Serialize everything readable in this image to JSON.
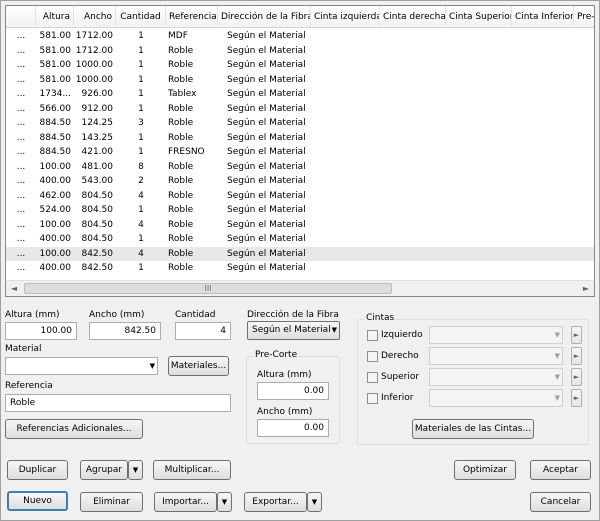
{
  "grid": {
    "columns": [
      "",
      "Altura",
      "Ancho",
      "Cantidad",
      "Referencia",
      "Dirección de la Fibra",
      "Cinta izquierda",
      "Cinta derecha",
      "Cinta Superior",
      "Cinta Inferior",
      "Pre-"
    ],
    "rows": [
      {
        "lead": "...",
        "altura": "581.00",
        "ancho": "1712.00",
        "cantidad": "1",
        "referencia": "MDF",
        "fibra": "Según el Material"
      },
      {
        "lead": "...",
        "altura": "581.00",
        "ancho": "1712.00",
        "cantidad": "1",
        "referencia": "Roble",
        "fibra": "Según el Material"
      },
      {
        "lead": "...",
        "altura": "581.00",
        "ancho": "1000.00",
        "cantidad": "1",
        "referencia": "Roble",
        "fibra": "Según el Material"
      },
      {
        "lead": "...",
        "altura": "581.00",
        "ancho": "1000.00",
        "cantidad": "1",
        "referencia": "Roble",
        "fibra": "Según el Material"
      },
      {
        "lead": "...",
        "altura": "1734...",
        "ancho": "926.00",
        "cantidad": "1",
        "referencia": "Tablex",
        "fibra": "Según el Material"
      },
      {
        "lead": "...",
        "altura": "566.00",
        "ancho": "912.00",
        "cantidad": "1",
        "referencia": "Roble",
        "fibra": "Según el Material"
      },
      {
        "lead": "...",
        "altura": "884.50",
        "ancho": "124.25",
        "cantidad": "3",
        "referencia": "Roble",
        "fibra": "Según el Material"
      },
      {
        "lead": "...",
        "altura": "884.50",
        "ancho": "143.25",
        "cantidad": "1",
        "referencia": "Roble",
        "fibra": "Según el Material"
      },
      {
        "lead": "...",
        "altura": "884.50",
        "ancho": "421.00",
        "cantidad": "1",
        "referencia": "FRESNO",
        "fibra": "Según el Material"
      },
      {
        "lead": "...",
        "altura": "100.00",
        "ancho": "481.00",
        "cantidad": "8",
        "referencia": "Roble",
        "fibra": "Según el Material"
      },
      {
        "lead": "...",
        "altura": "400.00",
        "ancho": "543.00",
        "cantidad": "2",
        "referencia": "Roble",
        "fibra": "Según el Material"
      },
      {
        "lead": "...",
        "altura": "462.00",
        "ancho": "804.50",
        "cantidad": "4",
        "referencia": "Roble",
        "fibra": "Según el Material"
      },
      {
        "lead": "...",
        "altura": "524.00",
        "ancho": "804.50",
        "cantidad": "1",
        "referencia": "Roble",
        "fibra": "Según el Material"
      },
      {
        "lead": "...",
        "altura": "100.00",
        "ancho": "804.50",
        "cantidad": "4",
        "referencia": "Roble",
        "fibra": "Según el Material"
      },
      {
        "lead": "...",
        "altura": "400.00",
        "ancho": "804.50",
        "cantidad": "1",
        "referencia": "Roble",
        "fibra": "Según el Material"
      },
      {
        "lead": "...",
        "altura": "100.00",
        "ancho": "842.50",
        "cantidad": "4",
        "referencia": "Roble",
        "fibra": "Según el Material",
        "selected": true
      },
      {
        "lead": "...",
        "altura": "400.00",
        "ancho": "842.50",
        "cantidad": "1",
        "referencia": "Roble",
        "fibra": "Según el Material"
      }
    ],
    "scroll_thumb_grip": "III",
    "scroll_left_icon": "◄",
    "scroll_right_icon": "►"
  },
  "form": {
    "altura_label": "Altura (mm)",
    "altura_value": "100.00",
    "ancho_label": "Ancho (mm)",
    "ancho_value": "842.50",
    "cantidad_label": "Cantidad",
    "cantidad_value": "4",
    "fibra_label": "Dirección de la Fibra",
    "fibra_value": "Según el Material",
    "material_label": "Material",
    "material_value": "",
    "materiales_button": "Materiales...",
    "referencia_label": "Referencia",
    "referencia_value": "Roble",
    "referencias_button": "Referencias Adicionales...",
    "precorte_title": "Pre-Corte",
    "precorte_altura_label": "Altura (mm)",
    "precorte_altura_value": "0.00",
    "precorte_ancho_label": "Ancho (mm)",
    "precorte_ancho_value": "0.00",
    "cintas_title": "Cintas",
    "cintas": [
      {
        "label": "Izquierdo"
      },
      {
        "label": "Derecho"
      },
      {
        "label": "Superior"
      },
      {
        "label": "Inferior"
      }
    ],
    "cintas_button": "Materiales de las Cintas..."
  },
  "buttons": {
    "duplicar": "Duplicar",
    "agrupar": "Agrupar",
    "multiplicar": "Multiplicar...",
    "optimizar": "Optimizar",
    "aceptar": "Aceptar",
    "nuevo": "Nuevo",
    "eliminar": "Eliminar",
    "importar": "Importar...",
    "exportar": "Exportar...",
    "cancelar": "Cancelar"
  },
  "icons": {
    "dropdown": "▼",
    "expand": "►"
  }
}
